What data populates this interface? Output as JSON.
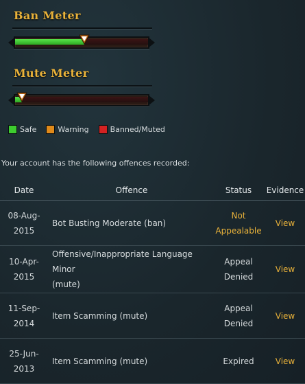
{
  "ban_meter": {
    "title": "Ban Meter",
    "level": 0.52
  },
  "mute_meter": {
    "title": "Mute Meter",
    "level": 0.05
  },
  "legend": [
    {
      "label": "Safe",
      "color": "#3dcc2f"
    },
    {
      "label": "Warning",
      "color": "#e08a1a"
    },
    {
      "label": "Banned/Muted",
      "color": "#d42222"
    }
  ],
  "intro_text": "Your account has the following offences recorded:",
  "table": {
    "headers": {
      "date": "Date",
      "offence": "Offence",
      "status": "Status",
      "evidence": "Evidence"
    },
    "rows": [
      {
        "date_line1": "08-Aug-",
        "date_line2": "2015",
        "offence_line1": "Bot Busting Moderate (ban)",
        "offence_line2": "",
        "status_line1": "Not",
        "status_line2": "Appealable",
        "status_color": "#e9b23a",
        "evidence": "View"
      },
      {
        "date_line1": "10-Apr-",
        "date_line2": "2015",
        "offence_line1": "Offensive/Inappropriate Language Minor",
        "offence_line2": "(mute)",
        "status_line1": "Appeal",
        "status_line2": "Denied",
        "status_color": "#d6dbdd",
        "evidence": "View"
      },
      {
        "date_line1": "11-Sep-",
        "date_line2": "2014",
        "offence_line1": "Item Scamming (mute)",
        "offence_line2": "",
        "status_line1": "Appeal",
        "status_line2": "Denied",
        "status_color": "#d6dbdd",
        "evidence": "View"
      },
      {
        "date_line1": "25-Jun-",
        "date_line2": "2013",
        "offence_line1": "Item Scamming (mute)",
        "offence_line2": "",
        "status_line1": "Expired",
        "status_line2": "",
        "status_color": "#d6dbdd",
        "evidence": "View"
      }
    ]
  }
}
